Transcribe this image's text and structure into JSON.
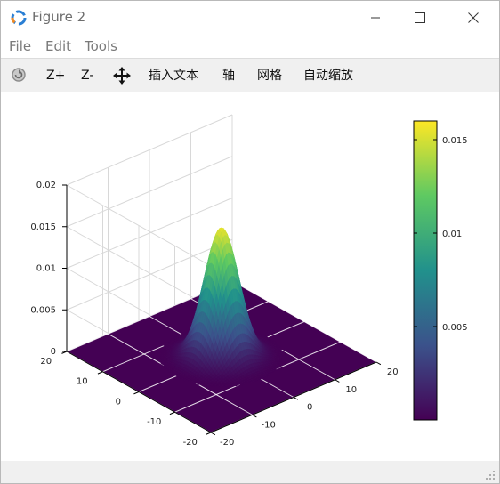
{
  "window": {
    "title": "Figure 2"
  },
  "menu": [
    {
      "label": "File",
      "key": "F",
      "rest": "ile"
    },
    {
      "label": "Edit",
      "key": "E",
      "rest": "dit"
    },
    {
      "label": "Tools",
      "key": "T",
      "rest": "ools"
    }
  ],
  "toolbar": {
    "zoom_in": "Z+",
    "zoom_out": "Z-",
    "insert_text": "插入文本",
    "axes": "轴",
    "grid": "网格",
    "autoscale": "自动缩放"
  },
  "icons": [
    "app-icon",
    "minimize-icon",
    "maximize-icon",
    "close-icon",
    "rotate-icon",
    "pan-icon",
    "resize-grip-icon"
  ],
  "colors": {
    "surface_base": "#440154",
    "colormap": [
      "#440154",
      "#3b528b",
      "#21918c",
      "#5ec962",
      "#fde725"
    ]
  },
  "chart_data": {
    "type": "surface",
    "title": "",
    "function": "bivariate gaussian centered at (0,0), sigma≈3.2",
    "xlim": [
      -20,
      20
    ],
    "ylim": [
      -20,
      20
    ],
    "zlim": [
      0,
      0.02
    ],
    "x_ticks": [
      -20,
      -10,
      0,
      10,
      20
    ],
    "y_ticks": [
      -20,
      -10,
      0,
      10,
      20
    ],
    "z_ticks": [
      0,
      0.005,
      0.01,
      0.015,
      0.02
    ],
    "x_tick_labels": [
      "-20",
      "-10",
      "0",
      "10",
      "20"
    ],
    "y_tick_labels": [
      "-20",
      "-10",
      "0",
      "10",
      "20"
    ],
    "z_tick_labels": [
      "0",
      "0.005",
      "0.01",
      "0.015",
      "0.02"
    ],
    "peak_value": 0.0155,
    "grid": true,
    "colorbar": {
      "min": 0,
      "max": 0.016,
      "ticks": [
        0.005,
        0.01,
        0.015
      ],
      "tick_labels": [
        "0.005",
        "0.01",
        "0.015"
      ]
    }
  }
}
